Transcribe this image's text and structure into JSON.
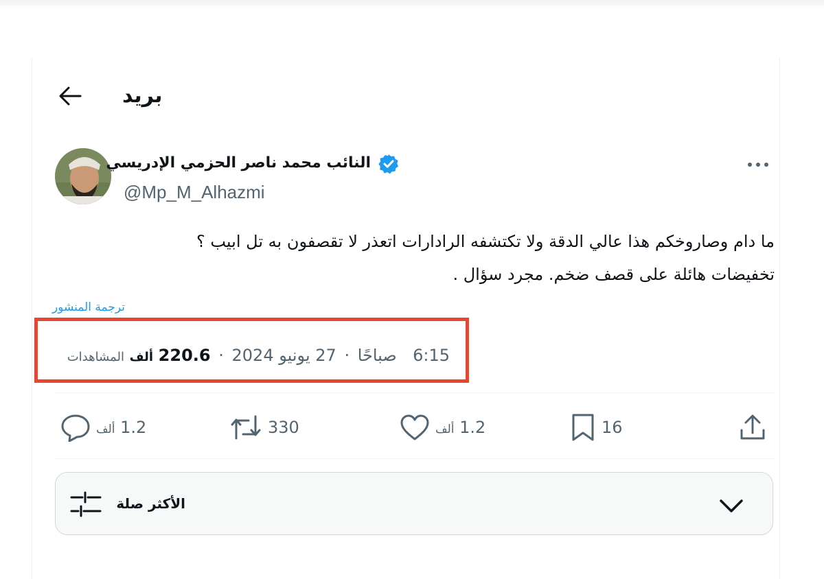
{
  "header": {
    "title": "بريد",
    "back_icon": "arrow-left-icon"
  },
  "author": {
    "name": "النائب محمد ناصر الحزمي الإدريسي",
    "handle": "@Mp_M_Alhazmi",
    "verified_icon": "verified-badge-icon",
    "verified_color": "#1d9bf0"
  },
  "tweet": {
    "lines": [
      "ما دام وصاروخكم هذا عالي الدقة ولا تكتشفه الرادارات اتعذر لا تقصفون به تل ابيب ؟",
      "تخفيضات هائلة على قصف ضخم. مجرد سؤال ."
    ],
    "translate_label": "ترجمة المنشور"
  },
  "meta": {
    "time": "6:15",
    "period": "صباحًا",
    "date": "27 يونيو 2024",
    "views_count": "220.6",
    "views_unit": "ألف",
    "views_label": "المشاهدات",
    "highlight_color": "#e8462f"
  },
  "actions": {
    "replies": {
      "count": "1.2",
      "unit": "ألف",
      "icon": "reply-icon"
    },
    "reposts": {
      "count": "330",
      "icon": "repost-icon"
    },
    "likes": {
      "count": "1.2",
      "unit": "ألف",
      "icon": "heart-icon"
    },
    "bookmarks": {
      "count": "16",
      "icon": "bookmark-icon"
    },
    "share": {
      "icon": "share-icon"
    }
  },
  "sort": {
    "label": "الأكثر صلة",
    "icon": "sliders-icon",
    "chevron": "chevron-down-icon"
  }
}
